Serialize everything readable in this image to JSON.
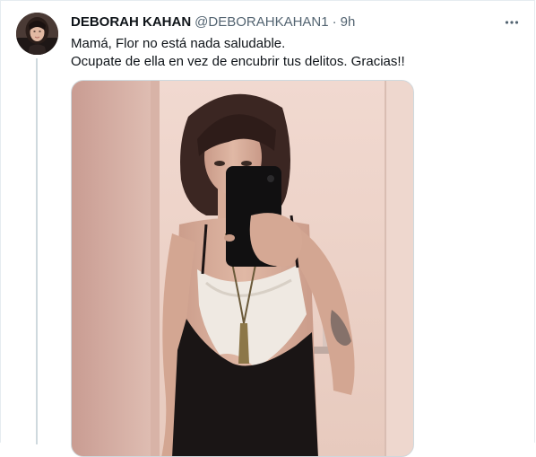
{
  "tweet": {
    "author": {
      "display_name": "DEBORAH KAHAN",
      "handle": "@DEBORAHKAHAN1",
      "separator": "·",
      "time": "9h"
    },
    "text_lines": [
      "Mamá, Flor no está nada saludable.",
      "Ocupate de ella en vez de encubrir tus delitos. Gracias!!"
    ],
    "more_icon": "more-horizontal-icon",
    "media": {
      "kind": "photo"
    }
  },
  "colors": {
    "primary_text": "#0f1419",
    "secondary_text": "#536471",
    "border": "#cfd9de",
    "background": "#ffffff"
  }
}
